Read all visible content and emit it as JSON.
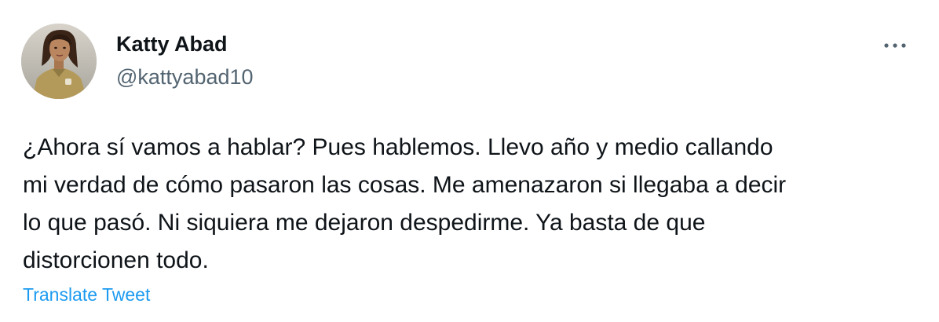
{
  "author": {
    "display_name": "Katty Abad",
    "handle": "@kattyabad10"
  },
  "tweet": {
    "lines": [
      "¿Ahora sí vamos a hablar? Pues hablemos. Llevo año y medio callando",
      "mi verdad de cómo pasaron las cosas. Me amenazaron si llegaba a decir",
      "lo que pasó. Ni siquiera me dejaron despedirme. Ya basta de que",
      "distorcionen todo."
    ]
  },
  "actions": {
    "translate_label": "Translate Tweet",
    "more_icon": "more-horizontal-icon"
  },
  "colors": {
    "text_primary": "#0f1419",
    "text_secondary": "#536471",
    "link": "#1d9bf0",
    "background": "#ffffff"
  }
}
